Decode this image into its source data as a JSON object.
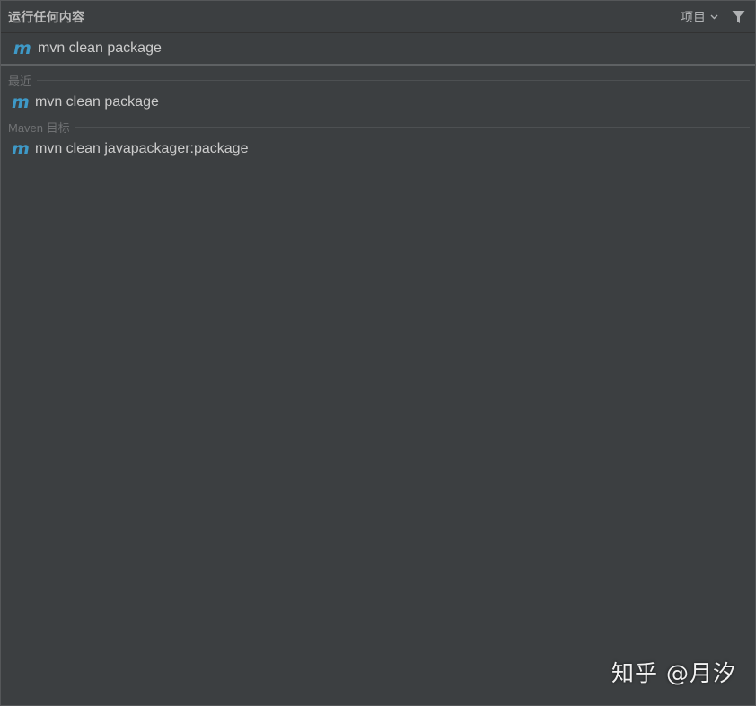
{
  "header": {
    "title": "运行任何内容",
    "scope_label": "项目",
    "scope_icon": "chevron-down-icon",
    "filter_icon": "filter-icon"
  },
  "search": {
    "value": "mvn clean package",
    "icon": "maven-icon",
    "icon_glyph": "m"
  },
  "sections": {
    "recent": {
      "label": "最近",
      "items": [
        {
          "icon_glyph": "m",
          "label": "mvn clean package"
        }
      ]
    },
    "maven_goals": {
      "label": "Maven 目标",
      "items": [
        {
          "icon_glyph": "m",
          "label": "mvn clean javapackager:package"
        }
      ]
    }
  },
  "watermark": "知乎 @月汐",
  "colors": {
    "background": "#3c3f41",
    "maven_icon": "#3e99c7",
    "text": "#cccccc",
    "section_label": "#707274"
  }
}
